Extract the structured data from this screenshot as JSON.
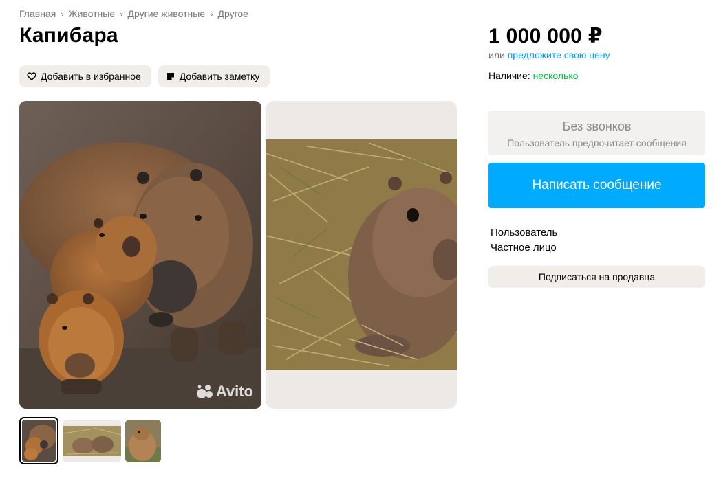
{
  "breadcrumb": [
    "Главная",
    "Животные",
    "Другие животные",
    "Другое"
  ],
  "title": "Капибара",
  "actions": {
    "favorite_label": "Добавить в избранное",
    "note_label": "Добавить заметку"
  },
  "gallery": {
    "watermark": "Avito",
    "thumb_count": 3,
    "active_thumb": 1
  },
  "price": {
    "value": "1 000 000 ₽",
    "or_text": "или",
    "offer_link": "предложите свою цену"
  },
  "availability": {
    "label": "Наличие:",
    "value": "несколько"
  },
  "contact": {
    "no_calls_title": "Без звонков",
    "no_calls_sub": "Пользователь предпочитает сообщения",
    "write_button": "Написать сообщение"
  },
  "seller": {
    "name": "Пользователь",
    "type": "Частное лицо",
    "subscribe_button": "Подписаться на продавца"
  },
  "colors": {
    "accent_blue": "#00aaff",
    "link_blue": "#0099ff",
    "availability_green": "#02c140",
    "button_bg": "#f1eeea"
  }
}
